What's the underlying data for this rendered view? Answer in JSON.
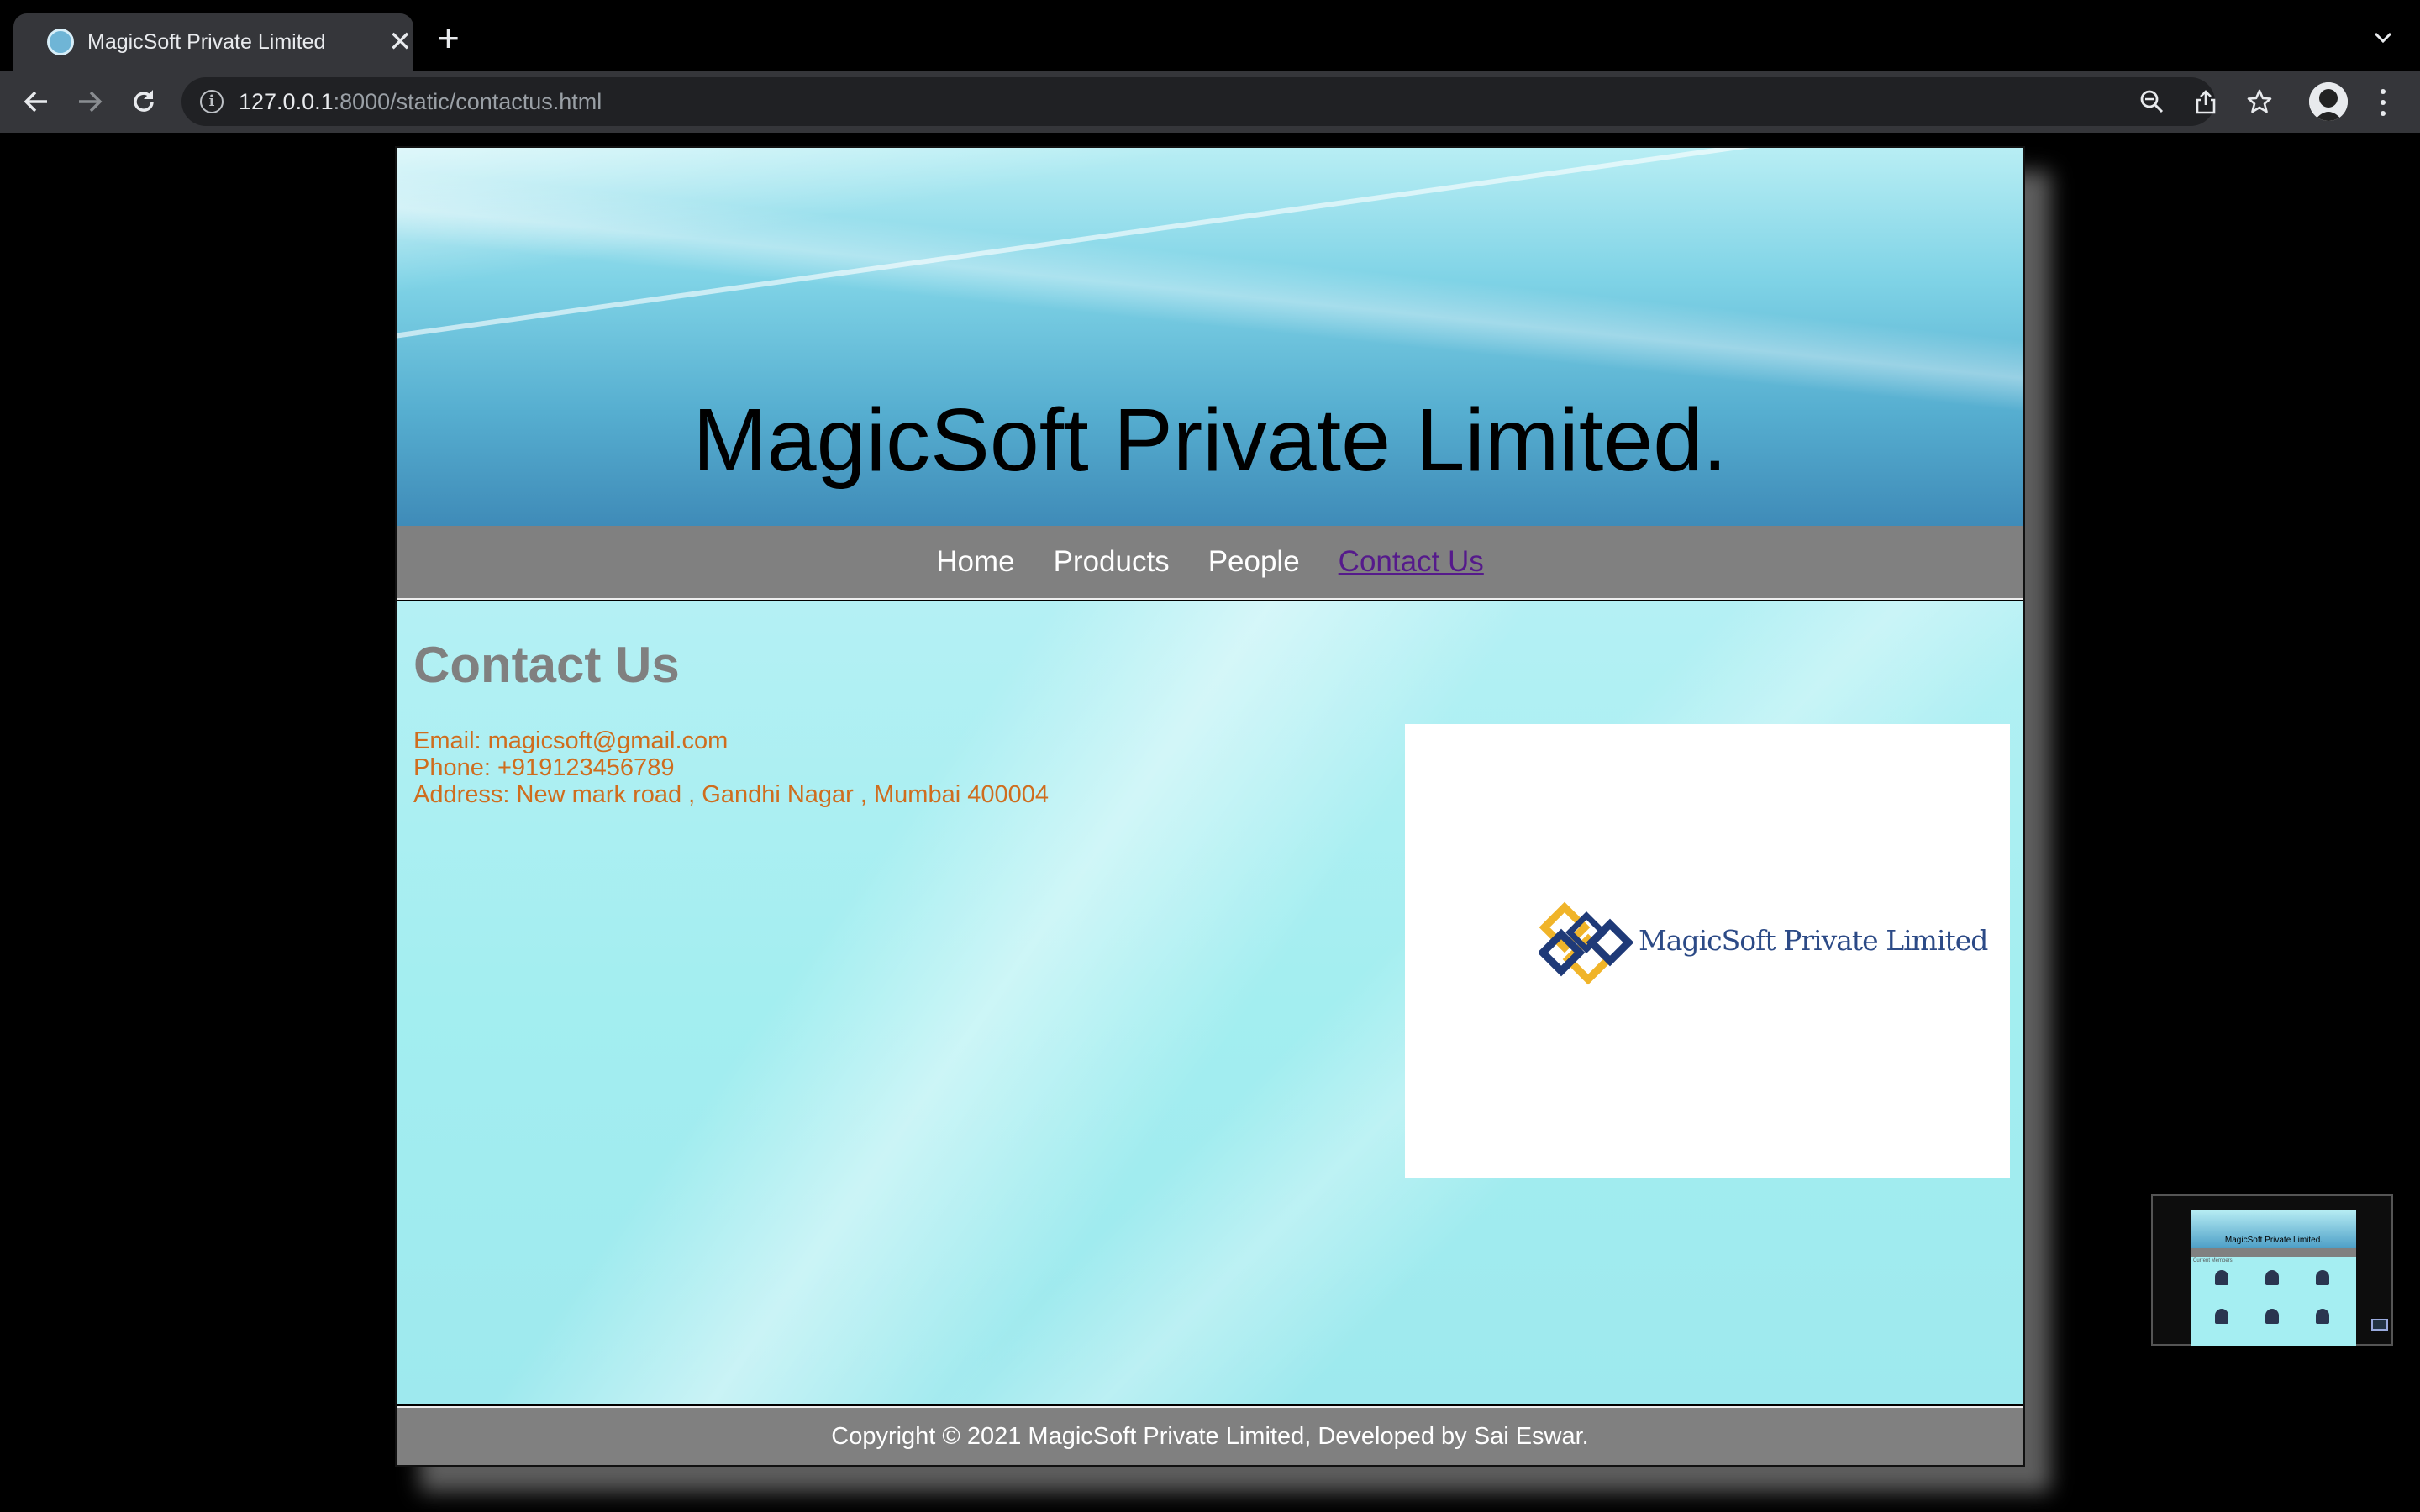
{
  "browser": {
    "tab_title": "MagicSoft Private Limited",
    "new_tab_glyph": "+",
    "close_glyph": "✕",
    "url_host": "127.0.0.1",
    "url_rest": ":8000/static/contactus.html"
  },
  "site": {
    "title": "MagicSoft Private Limited.",
    "nav": [
      {
        "label": "Home"
      },
      {
        "label": "Products"
      },
      {
        "label": "People"
      },
      {
        "label": "Contact Us",
        "active": true
      }
    ],
    "content": {
      "heading": "Contact Us",
      "email": "Email: magicsoft@gmail.com",
      "phone": "Phone: +919123456789",
      "address": "Address: New mark road , Gandhi Nagar , Mumbai 400004"
    },
    "logo": {
      "text": "MagicSoft Private Limited",
      "colors": {
        "gold": "#f0b429",
        "navy": "#1f3a78"
      }
    },
    "footer": "Copyright © 2021 MagicSoft Private Limited, Developed by Sai Eswar."
  },
  "pip_thumbnail": {
    "title": "MagicSoft Private Limited.",
    "label": "Current Members"
  },
  "colors": {
    "nav_bg": "#808080",
    "heading_gray": "#808080",
    "contact_orange": "#cf6d1e",
    "active_link": "#551a8b"
  }
}
